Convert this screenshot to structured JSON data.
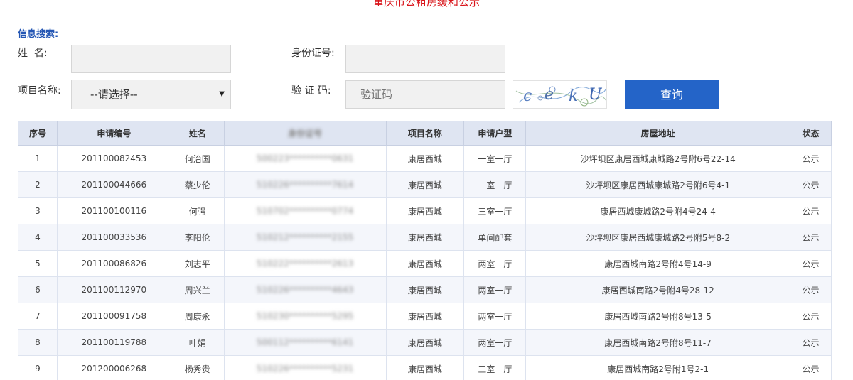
{
  "page": {
    "title": "重庆市公租房缓和公示"
  },
  "search": {
    "title": "信息搜索:",
    "name_label": "姓  名:",
    "id_label": "身份证号:",
    "project_label": "项目名称:",
    "project_selected": "--请选择--",
    "captcha_label": "验 证 码:",
    "captcha_placeholder": "验证码",
    "captcha_text": "c e k U",
    "query_label": "查询"
  },
  "table": {
    "headers": [
      "序号",
      "申请编号",
      "姓名",
      "身份证号",
      "项目名称",
      "申请户型",
      "房屋地址",
      "状态"
    ],
    "rows": [
      [
        "1",
        "201100082453",
        "何治国",
        "500223**********0631",
        "康居西城",
        "一室一厅",
        "沙坪坝区康居西城康城路2号附6号22-14",
        "公示"
      ],
      [
        "2",
        "201100044666",
        "蔡少伦",
        "510226**********7614",
        "康居西城",
        "一室一厅",
        "沙坪坝区康居西城康城路2号附6号4-1",
        "公示"
      ],
      [
        "3",
        "201100100116",
        "何强",
        "510702**********0774",
        "康居西城",
        "三室一厅",
        "康居西城康城路2号附4号24-4",
        "公示"
      ],
      [
        "4",
        "201100033536",
        "李阳伦",
        "510212**********2155",
        "康居西城",
        "单间配套",
        "沙坪坝区康居西城康城路2号附5号8-2",
        "公示"
      ],
      [
        "5",
        "201100086826",
        "刘志平",
        "510222**********2613",
        "康居西城",
        "两室一厅",
        "康居西城南路2号附4号14-9",
        "公示"
      ],
      [
        "6",
        "201100112970",
        "周兴兰",
        "510226**********4643",
        "康居西城",
        "两室一厅",
        "康居西城南路2号附4号28-12",
        "公示"
      ],
      [
        "7",
        "201100091758",
        "周康永",
        "510230**********5295",
        "康居西城",
        "两室一厅",
        "康居西城南路2号附8号13-5",
        "公示"
      ],
      [
        "8",
        "201100119788",
        "叶娟",
        "500112**********6141",
        "康居西城",
        "两室一厅",
        "康居西城南路2号附8号11-7",
        "公示"
      ],
      [
        "9",
        "201200006268",
        "杨秀贵",
        "510226**********5231",
        "康居西城",
        "三室一厅",
        "康居西城南路2号附1号2-1",
        "公示"
      ]
    ]
  },
  "icons": {
    "select_arrow": "dropdown-arrow-icon"
  }
}
